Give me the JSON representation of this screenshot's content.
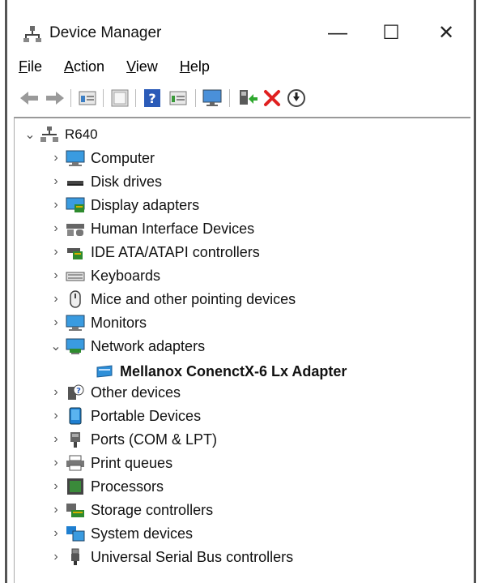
{
  "window": {
    "title": "Device Manager",
    "controls": {
      "minimize": "—",
      "maximize": "☐",
      "close": "✕"
    }
  },
  "menu": [
    {
      "label_u": "F",
      "label_rest": "ile"
    },
    {
      "label_u": "A",
      "label_rest": "ction"
    },
    {
      "label_u": "V",
      "label_rest": "iew"
    },
    {
      "label_u": "H",
      "label_rest": "elp"
    }
  ],
  "toolbar_icons": [
    "back-arrow-icon",
    "forward-arrow-icon",
    "properties-icon",
    "show-hidden-icon",
    "help-icon",
    "details-icon",
    "monitor-icon",
    "enable-device-icon",
    "uninstall-icon",
    "update-driver-icon"
  ],
  "tree": {
    "root": {
      "label": "R640",
      "expanded": true
    },
    "categories": [
      {
        "label": "Computer",
        "icon": "computer-icon",
        "expanded": false
      },
      {
        "label": "Disk drives",
        "icon": "disk-drive-icon",
        "expanded": false
      },
      {
        "label": "Display adapters",
        "icon": "display-adapter-icon",
        "expanded": false
      },
      {
        "label": "Human Interface Devices",
        "icon": "hid-icon",
        "expanded": false
      },
      {
        "label": "IDE ATA/ATAPI controllers",
        "icon": "ide-controller-icon",
        "expanded": false
      },
      {
        "label": "Keyboards",
        "icon": "keyboard-icon",
        "expanded": false
      },
      {
        "label": "Mice and other pointing devices",
        "icon": "mouse-icon",
        "expanded": false
      },
      {
        "label": "Monitors",
        "icon": "monitor-icon",
        "expanded": false
      },
      {
        "label": "Network adapters",
        "icon": "network-adapter-icon",
        "expanded": true,
        "children": [
          {
            "label": "Mellanox ConenctX-6 Lx Adapter",
            "icon": "network-card-icon"
          }
        ]
      },
      {
        "label": "Other devices",
        "icon": "other-devices-icon",
        "expanded": false
      },
      {
        "label": "Portable Devices",
        "icon": "portable-device-icon",
        "expanded": false
      },
      {
        "label": "Ports (COM & LPT)",
        "icon": "port-icon",
        "expanded": false
      },
      {
        "label": "Print queues",
        "icon": "printer-icon",
        "expanded": false
      },
      {
        "label": "Processors",
        "icon": "processor-icon",
        "expanded": false
      },
      {
        "label": "Storage controllers",
        "icon": "storage-controller-icon",
        "expanded": false
      },
      {
        "label": "System devices",
        "icon": "system-devices-icon",
        "expanded": false
      },
      {
        "label": "Universal Serial Bus controllers",
        "icon": "usb-icon",
        "expanded": false
      }
    ]
  },
  "chevrons": {
    "collapsed": "›",
    "expanded": "⌄"
  }
}
